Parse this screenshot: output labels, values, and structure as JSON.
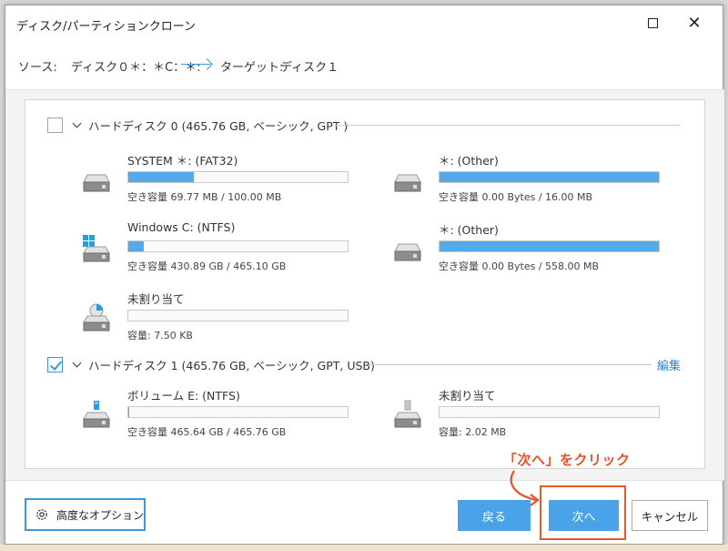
{
  "window": {
    "title": "ディスク/パーティションクローン"
  },
  "source_bar": {
    "source_label": "ソース:",
    "source_value": "ディスク０＊：＊C：＊:",
    "target_label": "ターゲット:",
    "target_value": "ディスク１"
  },
  "disks": [
    {
      "label": "ハードディスク 0 (465.76 GB, ベーシック, GPT )",
      "checked": false,
      "partitions": [
        {
          "name": "SYSTEM ＊: (FAT32)",
          "info": "空き容量 69.77 MB / 100.00 MB",
          "used_fraction": 0.3,
          "icon": "drive-icon"
        },
        {
          "name": "＊: (Other)",
          "info": "空き容量 0.00 Bytes / 16.00 MB",
          "used_fraction": 1.0,
          "icon": "drive-icon"
        },
        {
          "name": "Windows C: (NTFS)",
          "info": "空き容量 430.89 GB / 465.10 GB",
          "used_fraction": 0.07,
          "icon": "windows-drive-icon"
        },
        {
          "name": "＊: (Other)",
          "info": "空き容量 0.00 Bytes / 558.00 MB",
          "used_fraction": 1.0,
          "icon": "drive-icon"
        },
        {
          "name": "未割り当て",
          "info": "容量: 7.50 KB",
          "used_fraction": 0.0,
          "icon": "unallocated-drive-icon"
        }
      ]
    },
    {
      "label": "ハードディスク 1 (465.76 GB, ベーシック, GPT, USB)",
      "checked": true,
      "edit_label": "編集",
      "partitions": [
        {
          "name": "ボリューム E: (NTFS)",
          "info": "空き容量 465.64 GB / 465.76 GB",
          "used_fraction": 0.005,
          "icon": "usb-drive-icon"
        },
        {
          "name": "未割り当て",
          "info": "容量: 2.02 MB",
          "used_fraction": 0.0,
          "icon": "usb-drive-gray-icon"
        }
      ]
    }
  ],
  "footer": {
    "advanced_label": "高度なオプション",
    "back_label": "戻る",
    "next_label": "次へ",
    "cancel_label": "キャンセル"
  },
  "annotation": {
    "text": "「次へ」をクリック",
    "color": "#e8502a"
  },
  "colors": {
    "accent": "#4aa3e8",
    "bar_fill": "#56a9e8",
    "highlight": "#e25b2a"
  }
}
